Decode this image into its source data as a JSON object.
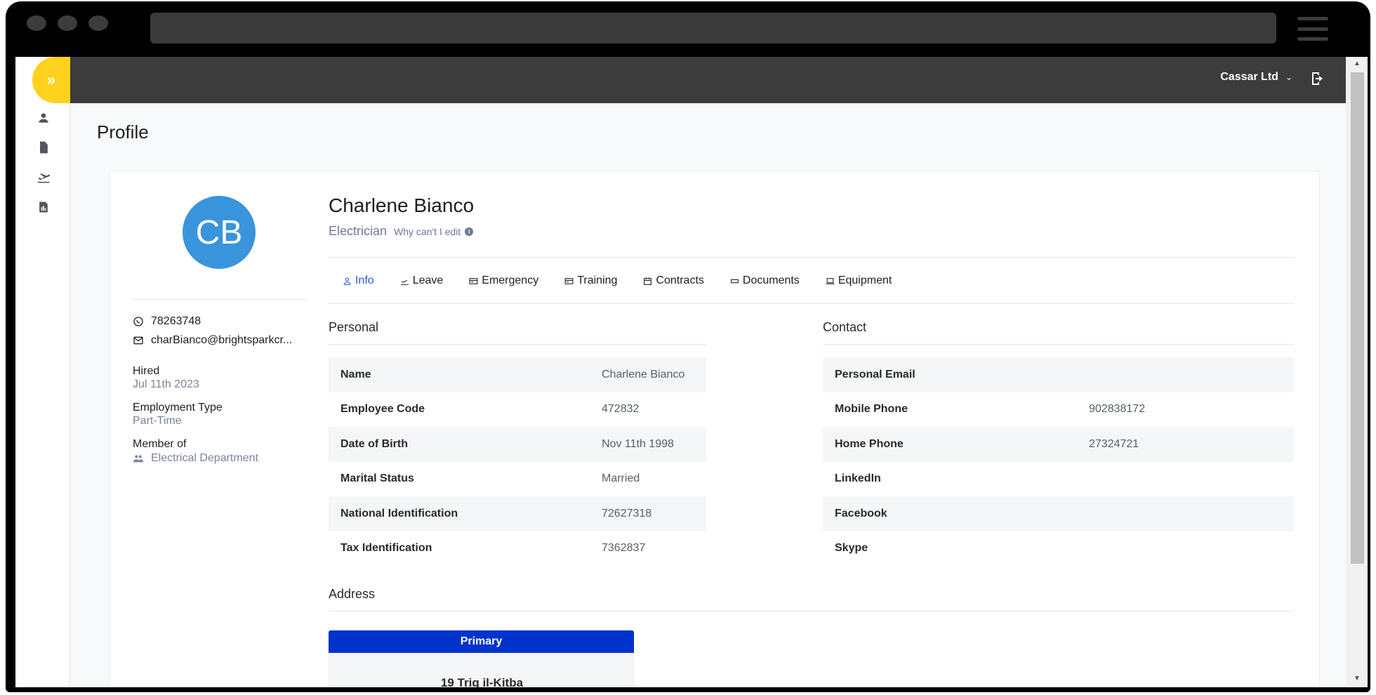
{
  "header": {
    "company": "Cassar Ltd"
  },
  "page": {
    "title": "Profile"
  },
  "profile": {
    "initials": "CB",
    "name": "Charlene Bianco",
    "role": "Electrician",
    "why_edit": "Why can't I edit",
    "phone": "78263748",
    "email": "charBianco@brightsparkcr...",
    "hired_label": "Hired",
    "hired_value": "Jul 11th 2023",
    "employment_type_label": "Employment Type",
    "employment_type_value": "Part-Time",
    "member_label": "Member of",
    "member_value": "Electrical Department"
  },
  "tabs": [
    "Info",
    "Leave",
    "Emergency",
    "Training",
    "Contracts",
    "Documents",
    "Equipment"
  ],
  "personal": {
    "title": "Personal",
    "rows": [
      {
        "label": "Name",
        "value": "Charlene Bianco"
      },
      {
        "label": "Employee Code",
        "value": "472832"
      },
      {
        "label": "Date of Birth",
        "value": "Nov 11th 1998"
      },
      {
        "label": "Marital Status",
        "value": "Married"
      },
      {
        "label": "National Identification",
        "value": "72627318"
      },
      {
        "label": "Tax Identification",
        "value": "7362837"
      }
    ]
  },
  "contact": {
    "title": "Contact",
    "rows": [
      {
        "label": "Personal Email",
        "value": ""
      },
      {
        "label": "Mobile Phone",
        "value": "902838172"
      },
      {
        "label": "Home Phone",
        "value": "27324721"
      },
      {
        "label": "LinkedIn",
        "value": ""
      },
      {
        "label": "Facebook",
        "value": ""
      },
      {
        "label": "Skype",
        "value": ""
      }
    ]
  },
  "address": {
    "title": "Address",
    "primary_label": "Primary",
    "line1": "19 Triq il-Kitba"
  },
  "colors": {
    "accent": "#ffd21f",
    "brand_blue": "#0033cc",
    "tab_active": "#2e5bce",
    "avatar": "#3a94db"
  }
}
